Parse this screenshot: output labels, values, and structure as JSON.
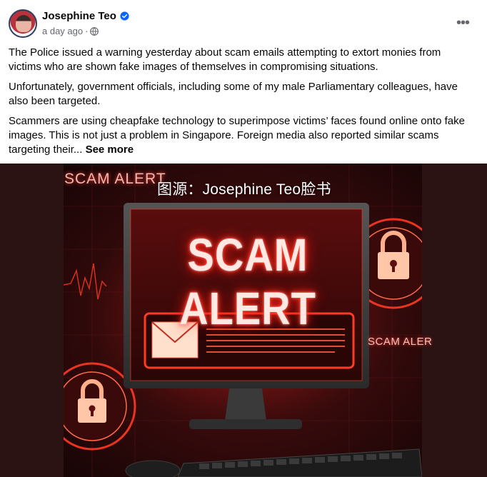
{
  "post": {
    "author": "Josephine Teo",
    "timestamp": "a day ago",
    "separator": "·",
    "audience_icon": "globe-icon",
    "verified_icon": "verified-badge-icon",
    "more_icon": "•••",
    "paragraphs": [
      "The Police issued a warning yesterday about scam emails attempting to extort monies from victims who are shown fake images of themselves in compromising situations.",
      "Unfortunately, government officials, including some of my male Parliamentary colleagues, have also been targeted.",
      "Scammers are using cheapfake technology to superimpose victims’ faces found online onto fake images. This is not just a problem in Singapore. Foreign media also reported similar scams targeting their..."
    ],
    "see_more": "See more"
  },
  "image": {
    "caption": "图源：Josephine Teo脸书",
    "screen_title": "SCAM ALERT",
    "corner_text": "SCAM ALERT",
    "side_text": "SCAM ALER"
  },
  "colors": {
    "verified_blue": "#0866ff",
    "meta_gray": "#65676b",
    "glow_red": "#ff2a1a"
  }
}
